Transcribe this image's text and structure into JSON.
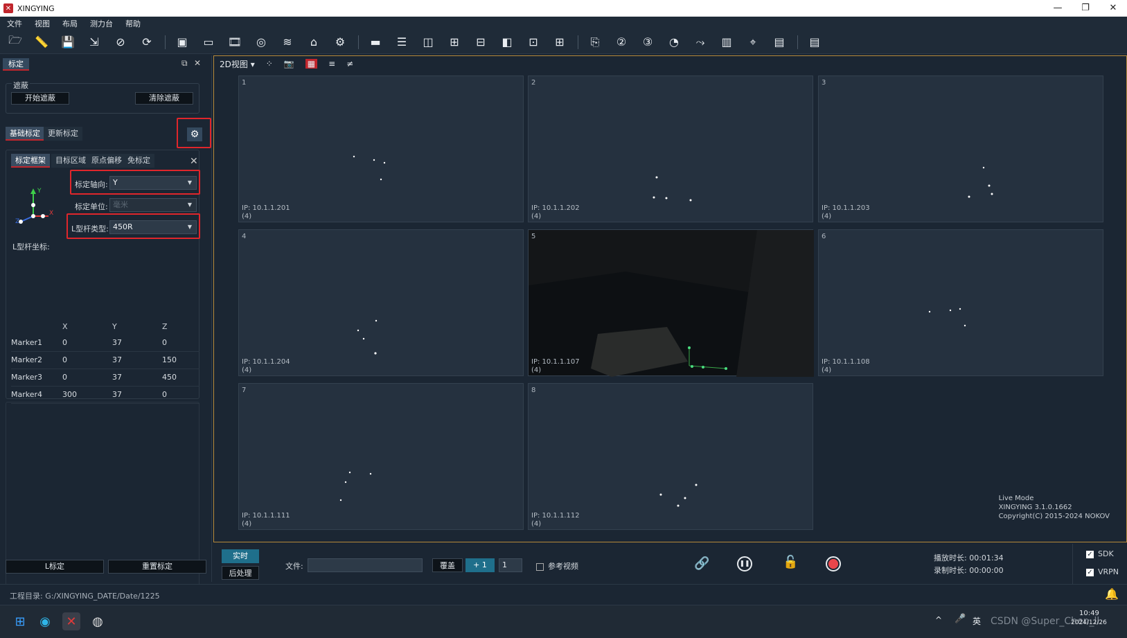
{
  "window": {
    "title": "XINGYING",
    "minimize": "—",
    "maximize": "❐",
    "close": "✕"
  },
  "menu": [
    "文件",
    "视图",
    "布局",
    "测力台",
    "帮助"
  ],
  "left_panel": {
    "tab": "标定",
    "mask": {
      "group_label": "遮蔽",
      "start_btn": "开始遮蔽",
      "clear_btn": "清除遮蔽"
    },
    "calib_tabs": [
      "基础标定",
      "更新标定"
    ],
    "sub_tabs": [
      "标定框架",
      "目标区域",
      "原点偏移",
      "免标定"
    ],
    "axis_label": "标定轴向:",
    "axis_value": "Y",
    "unit_label": "标定单位:",
    "unit_value": "毫米",
    "rod_label": "L型杆类型:",
    "rod_value": "450R",
    "coord_title": "L型杆坐标:",
    "axes_icon": {
      "y": "Y",
      "x": "X",
      "z": "Z"
    },
    "coord_headers": [
      "",
      "X",
      "Y",
      "Z"
    ],
    "coord_rows": [
      [
        "Marker1",
        "0",
        "37",
        "0"
      ],
      [
        "Marker2",
        "0",
        "37",
        "150"
      ],
      [
        "Marker3",
        "0",
        "37",
        "450"
      ],
      [
        "Marker4",
        "300",
        "37",
        "0"
      ]
    ],
    "l_calib_btn": "L标定",
    "reset_btn": "重置标定"
  },
  "view": {
    "mode": "2D视图",
    "cameras": [
      {
        "num": "1",
        "ip": "IP: 10.1.1.201",
        "count": "(4)"
      },
      {
        "num": "2",
        "ip": "IP: 10.1.1.202",
        "count": "(4)"
      },
      {
        "num": "3",
        "ip": "IP: 10.1.1.203",
        "count": "(4)"
      },
      {
        "num": "4",
        "ip": "IP: 10.1.1.204",
        "count": "(4)"
      },
      {
        "num": "5",
        "ip": "IP: 10.1.1.107",
        "count": "(4)"
      },
      {
        "num": "6",
        "ip": "IP: 10.1.1.108",
        "count": "(4)"
      },
      {
        "num": "7",
        "ip": "IP: 10.1.1.111",
        "count": "(4)"
      },
      {
        "num": "8",
        "ip": "IP: 10.1.1.112",
        "count": "(4)"
      }
    ],
    "live_info": {
      "mode": "Live Mode",
      "version": "XINGYING 3.1.0.1662",
      "copyright": "Copyright(C) 2015-2024 NOKOV"
    }
  },
  "bottom": {
    "realtime_btn": "实时",
    "post_btn": "后处理",
    "file_label": "文件:",
    "overwrite_btn": "覆盖",
    "plus_btn": "+ 1",
    "spin_value": "1",
    "ref_video": "参考视频",
    "play_time": "播放时长: 00:01:34",
    "rec_time": "录制时长: 00:00:00",
    "sdk": "SDK",
    "vrpn": "VRPN"
  },
  "status": {
    "project_dir": "工程目录: G:/XINGYING_DATE/Date/1225"
  },
  "taskbar": {
    "ime": "英",
    "time": "10:49",
    "date": "2024/12/26",
    "watermark": "CSDN @Super_Chen_ll"
  }
}
